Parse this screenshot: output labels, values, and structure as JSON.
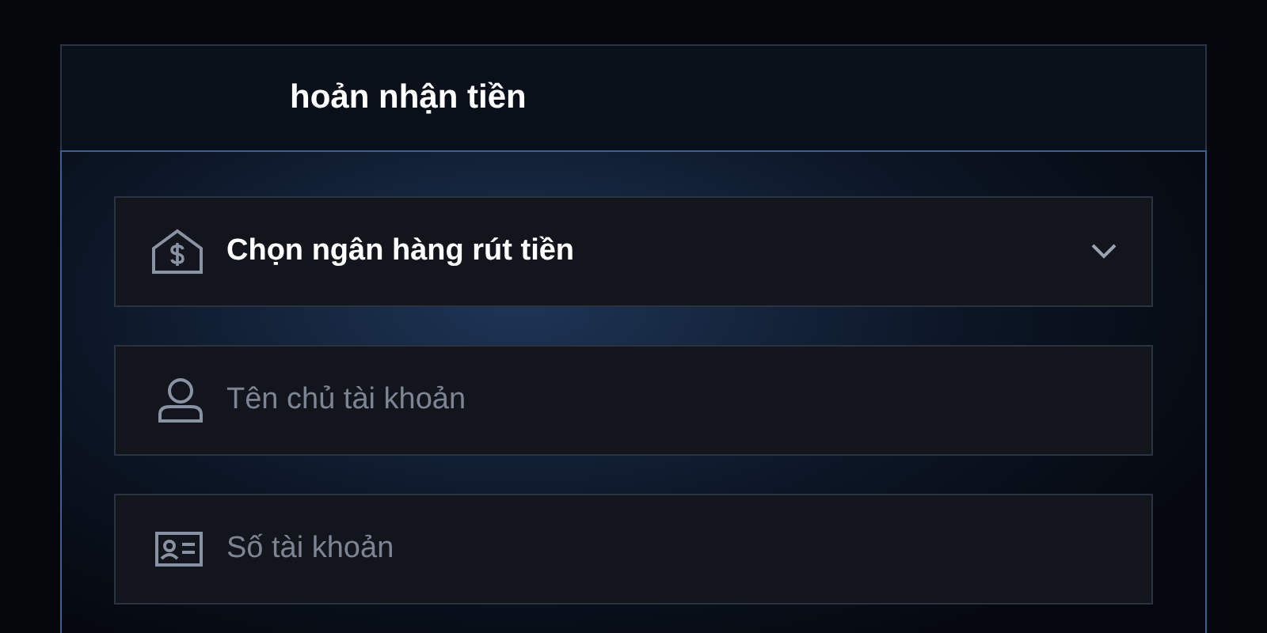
{
  "panel": {
    "title": "hoản nhận tiền"
  },
  "bank_select": {
    "label": "Chọn ngân hàng rút tiền"
  },
  "fields": [
    {
      "kind": "person",
      "placeholder": "Tên chủ tài khoản"
    },
    {
      "kind": "card",
      "placeholder": "Số tài khoản"
    }
  ]
}
